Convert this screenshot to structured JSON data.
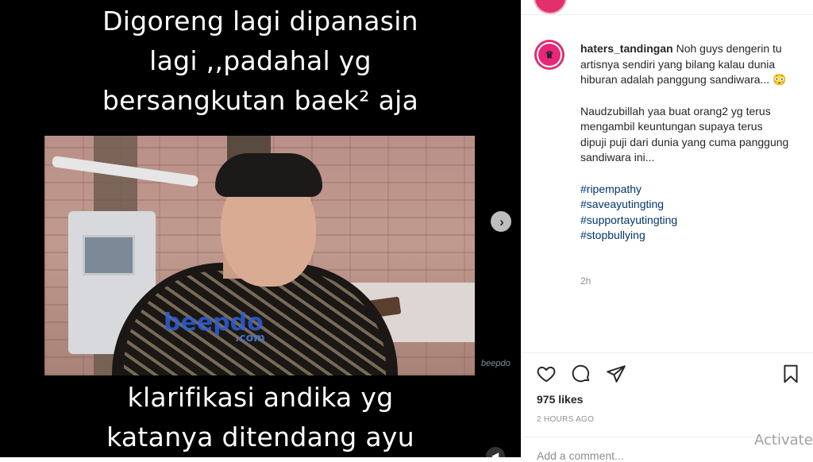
{
  "post_media": {
    "caption_top_lines": [
      "Digoreng lagi dipanasin",
      "lagi ,,padahal yg",
      "bersangkutan baek² aja"
    ],
    "caption_bottom_lines": [
      "klarifikasi andika yg",
      "katanya ditendang ayu"
    ],
    "video_watermark": "beepdo",
    "video_watermark_sub": ".com",
    "corner_logo": "beepdo"
  },
  "comment": {
    "username": "haters_tandingan",
    "paragraph1": "Noh guys dengerin tu artisnya sendiri yang bilang kalau dunia hiburan adalah panggung sandiwara... 😳",
    "paragraph2": "Naudzubillah yaa buat orang2 yg terus mengambil keuntungan supaya terus dipuji puji dari dunia yang cuma panggung sandiwara ini...",
    "hashtags": [
      "#ripempathy",
      "#saveayutingting",
      "#supportayutingting",
      "#stopbullying"
    ],
    "time": "2h"
  },
  "footer": {
    "likes": "975 likes",
    "timeago": "2 HOURS AGO",
    "add_comment_placeholder": "Add a comment..."
  },
  "overlay": {
    "activate_text": "Activate"
  }
}
